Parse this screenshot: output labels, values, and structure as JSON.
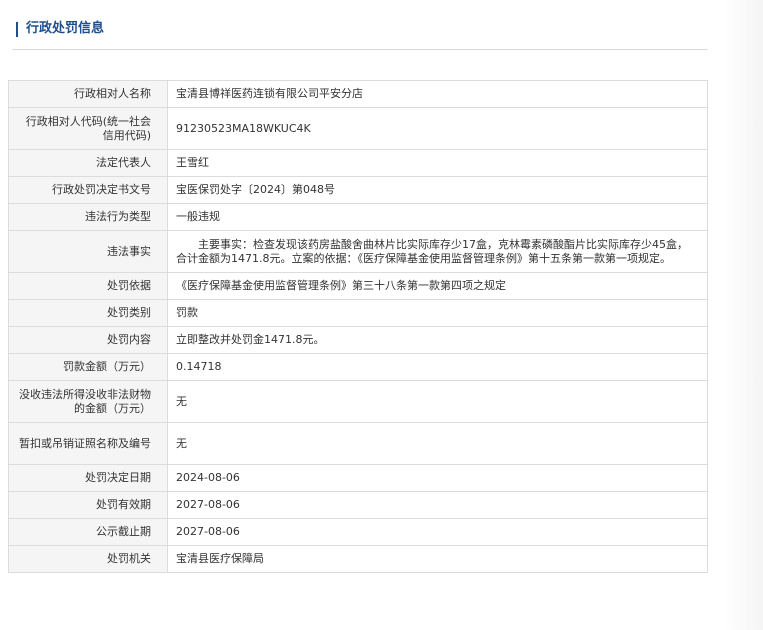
{
  "section": {
    "title": "行政处罚信息"
  },
  "rows": [
    {
      "label": "行政相对人名称",
      "value": "宝清县博祥医药连锁有限公司平安分店"
    },
    {
      "label": "行政相对人代码(统一社会信用代码)",
      "value": "91230523MA18WKUC4K"
    },
    {
      "label": "法定代表人",
      "value": "王雪红"
    },
    {
      "label": "行政处罚决定书文号",
      "value": "宝医保罚处字〔2024〕第048号"
    },
    {
      "label": "违法行为类型",
      "value": "一般违规"
    },
    {
      "label": "违法事实",
      "value": "主要事实：检查发现该药房盐酸舍曲林片比实际库存少17盒，克林霉素磷酸酯片比实际库存少45盒，合计金额为1471.8元。立案的依据：《医疗保障基金使用监督管理条例》第十五条第一款第一项规定。"
    },
    {
      "label": "处罚依据",
      "value": "《医疗保障基金使用监督管理条例》第三十八条第一款第四项之规定"
    },
    {
      "label": "处罚类别",
      "value": "罚款"
    },
    {
      "label": "处罚内容",
      "value": "立即整改并处罚金1471.8元。"
    },
    {
      "label": "罚款金额（万元）",
      "value": "0.14718"
    },
    {
      "label": "没收违法所得没收非法财物的金额（万元）",
      "value": "无"
    },
    {
      "label": "暂扣或吊销证照名称及编号",
      "value": "无"
    },
    {
      "label": "处罚决定日期",
      "value": "2024-08-06"
    },
    {
      "label": "处罚有效期",
      "value": "2027-08-06"
    },
    {
      "label": "公示截止期",
      "value": "2027-08-06"
    },
    {
      "label": "处罚机关",
      "value": "宝清县医疗保障局"
    }
  ]
}
